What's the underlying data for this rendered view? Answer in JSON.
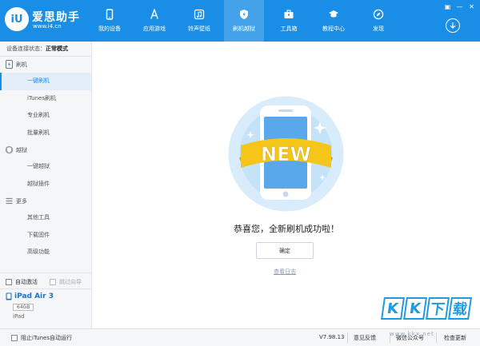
{
  "header": {
    "logo_text": "iU",
    "brand_name": "爱思助手",
    "brand_url": "www.i4.cn",
    "nav": [
      {
        "label": "我的设备",
        "icon": "phone-icon"
      },
      {
        "label": "应用游戏",
        "icon": "app-store-icon"
      },
      {
        "label": "铃声壁纸",
        "icon": "music-icon"
      },
      {
        "label": "刷机越狱",
        "icon": "shield-icon",
        "active": true
      },
      {
        "label": "工具箱",
        "icon": "toolbox-icon"
      },
      {
        "label": "教程中心",
        "icon": "graduation-cap-icon"
      },
      {
        "label": "发现",
        "icon": "compass-icon"
      }
    ],
    "window_controls": [
      "▣",
      "—",
      "✕"
    ]
  },
  "sidebar": {
    "status_label": "设备连接状态：",
    "status_value": "正常模式",
    "sections": [
      {
        "title": "刷机",
        "icon": "flash-icon",
        "items": [
          "一键刷机",
          "iTunes刷机",
          "专业刷机",
          "批量刷机"
        ]
      },
      {
        "title": "越狱",
        "icon": "jailbreak-icon",
        "items": [
          "一键越狱",
          "越狱插件"
        ]
      },
      {
        "title": "更多",
        "icon": "more-icon",
        "items": [
          "其他工具",
          "下载固件",
          "高级功能"
        ]
      }
    ],
    "active_item": "一键刷机",
    "auto_activate": "自动激活",
    "skip_guide": "跳过向导",
    "device": {
      "name": "iPad Air 3",
      "capacity": "64GB",
      "type": "iPad"
    }
  },
  "main": {
    "badge_text": "NEW",
    "message": "恭喜您，全新刷机成功啦！",
    "confirm_label": "确定",
    "log_link": "查看日志"
  },
  "footer": {
    "block_itunes": "阻止iTunes自动运行",
    "version": "V7.98.13",
    "feedback": "意见反馈",
    "wechat": "微信公众号",
    "check_update": "检查更新"
  },
  "watermark": {
    "chars": [
      "K",
      "K",
      "下",
      "载"
    ],
    "url": "www.kkx.net"
  },
  "colors": {
    "primary": "#1a8ee6",
    "ribbon": "#f5c518",
    "phone": "#5aa8ec"
  }
}
